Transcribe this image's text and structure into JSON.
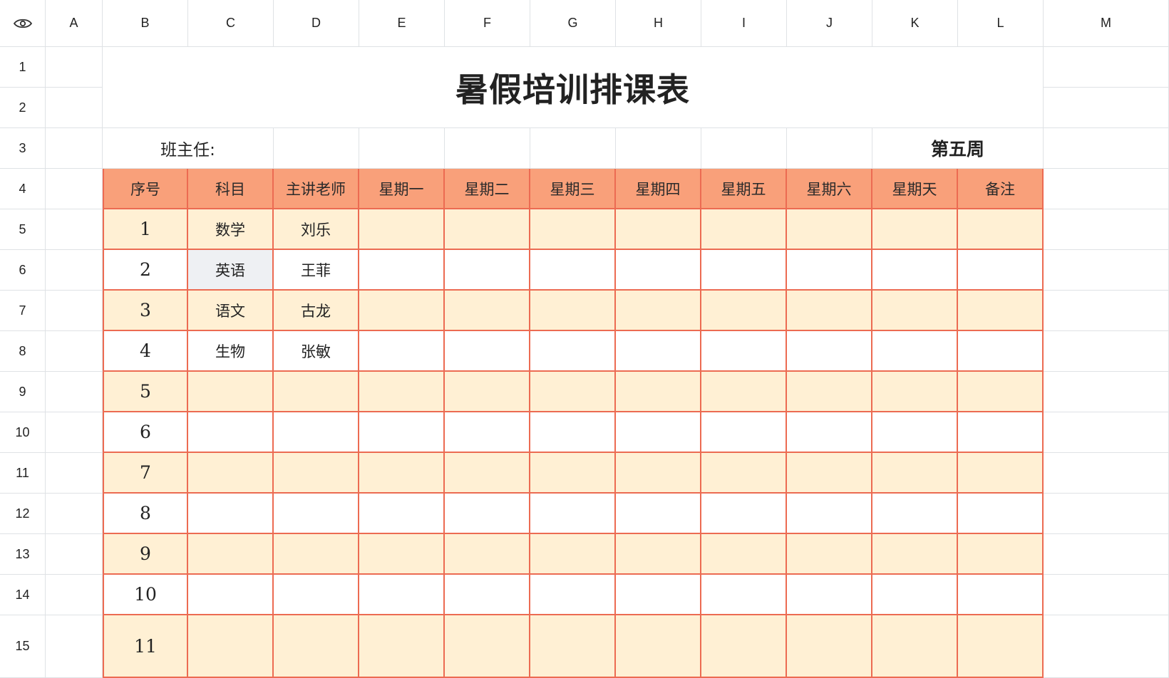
{
  "columns": [
    "A",
    "B",
    "C",
    "D",
    "E",
    "F",
    "G",
    "H",
    "I",
    "J",
    "K",
    "L",
    "M"
  ],
  "rows": [
    "1",
    "2",
    "3",
    "4",
    "5",
    "6",
    "7",
    "8",
    "9",
    "10",
    "11",
    "12",
    "13",
    "14",
    "15"
  ],
  "sheet": {
    "title": "暑假培训排课表",
    "head_teacher_label": "班主任:",
    "week_label": "第五周"
  },
  "table": {
    "headers": [
      "序号",
      "科目",
      "主讲老师",
      "星期一",
      "星期二",
      "星期三",
      "星期四",
      "星期五",
      "星期六",
      "星期天",
      "备注"
    ],
    "rows": [
      [
        "1",
        "数学",
        "刘乐",
        "",
        "",
        "",
        "",
        "",
        "",
        "",
        ""
      ],
      [
        "2",
        "英语",
        "王菲",
        "",
        "",
        "",
        "",
        "",
        "",
        "",
        ""
      ],
      [
        "3",
        "语文",
        "古龙",
        "",
        "",
        "",
        "",
        "",
        "",
        "",
        ""
      ],
      [
        "4",
        "生物",
        "张敏",
        "",
        "",
        "",
        "",
        "",
        "",
        "",
        ""
      ],
      [
        "5",
        "",
        "",
        "",
        "",
        "",
        "",
        "",
        "",
        "",
        ""
      ],
      [
        "6",
        "",
        "",
        "",
        "",
        "",
        "",
        "",
        "",
        "",
        ""
      ],
      [
        "7",
        "",
        "",
        "",
        "",
        "",
        "",
        "",
        "",
        "",
        ""
      ],
      [
        "8",
        "",
        "",
        "",
        "",
        "",
        "",
        "",
        "",
        "",
        ""
      ],
      [
        "9",
        "",
        "",
        "",
        "",
        "",
        "",
        "",
        "",
        "",
        ""
      ],
      [
        "10",
        "",
        "",
        "",
        "",
        "",
        "",
        "",
        "",
        "",
        ""
      ],
      [
        "11",
        "",
        "",
        "",
        "",
        "",
        "",
        "",
        "",
        "",
        ""
      ]
    ],
    "selected_cell": "C6"
  },
  "colors": {
    "header_fill": "#f9a07a",
    "border": "#ec6b52",
    "stripe": "#fff0d4",
    "selection": "#eef0f3"
  },
  "icons": {
    "corner": "eye-icon"
  }
}
